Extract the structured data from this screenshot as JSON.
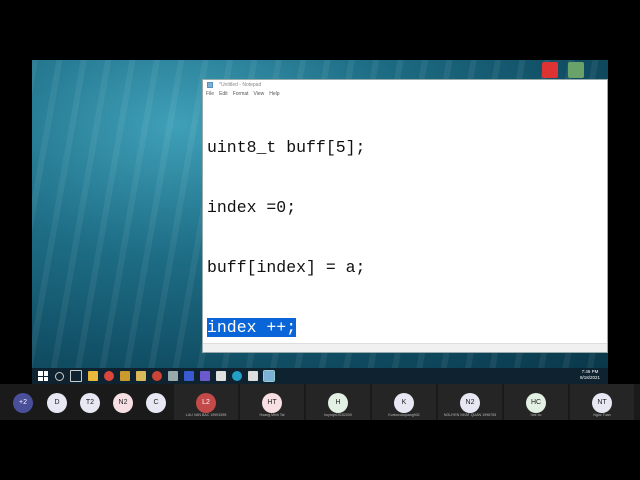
{
  "notepad": {
    "title": "*Untitled - Notepad",
    "menu": [
      "File",
      "Edit",
      "Format",
      "View",
      "Help"
    ],
    "lines": [
      "uint8_t buff[5];",
      "index =0;",
      "buff[index] = a;",
      "index ++;"
    ],
    "selected_line": 3
  },
  "taskbar": {
    "clock_time": "7:46 PM",
    "clock_date": "9/18/2021"
  },
  "participants": [
    {
      "initials": "+2",
      "name": "",
      "color": "#4a4f9a",
      "text_color": "#ffffff"
    },
    {
      "initials": "D",
      "name": "",
      "color": "#e7e8f3",
      "text_color": "#222222"
    },
    {
      "initials": "T2",
      "name": "",
      "color": "#e7e8f3",
      "text_color": "#222222"
    },
    {
      "initials": "N2",
      "name": "",
      "color": "#f7dfe3",
      "text_color": "#222222"
    },
    {
      "initials": "C",
      "name": "",
      "color": "#e7e8f3",
      "text_color": "#222222"
    },
    {
      "initials": "L2",
      "name": "LUU VAN BAC 19991595",
      "color": "#c44a4a",
      "text_color": "#ffffff"
    },
    {
      "initials": "HT",
      "name": "Hoang Minh Tai",
      "color": "#f7dfe3",
      "text_color": "#222222"
    },
    {
      "initials": "H",
      "name": "huynqn19152000",
      "color": "#e2f1e4",
      "text_color": "#222222"
    },
    {
      "initials": "K",
      "name": "Kurbocuoquang902",
      "color": "#e7e8f3",
      "text_color": "#222222"
    },
    {
      "initials": "N2",
      "name": "NGUYEN NHAT QUAN 1996705",
      "color": "#e7e8f3",
      "text_color": "#222222"
    },
    {
      "initials": "HC",
      "name": "hoe co",
      "color": "#e2f1e4",
      "text_color": "#222222"
    },
    {
      "initials": "NT",
      "name": "Ngoc Tuan",
      "color": "#e7e8f3",
      "text_color": "#222222"
    }
  ]
}
